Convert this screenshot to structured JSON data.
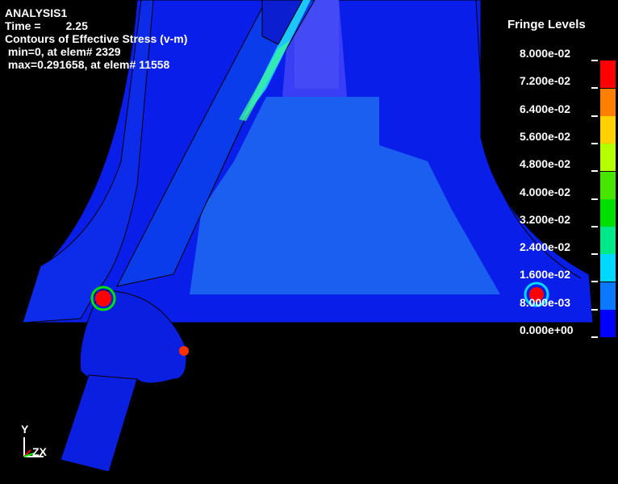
{
  "header": {
    "analysis": "ANALYSIS1",
    "time_line": "Time =        2.25",
    "contour_line": "Contours of Effective Stress (v-m)",
    "min_line": " min=0, at elem# 2329",
    "max_line": " max=0.291658, at elem# 11558"
  },
  "legend": {
    "title": "Fringe Levels",
    "levels": [
      {
        "label": "8.000e-02",
        "color": null
      },
      {
        "label": "7.200e-02",
        "color": "#ff0000"
      },
      {
        "label": "6.400e-02",
        "color": "#ff7f00"
      },
      {
        "label": "5.600e-02",
        "color": "#ffd200"
      },
      {
        "label": "4.800e-02",
        "color": "#b5ff00"
      },
      {
        "label": "4.000e-02",
        "color": "#46e600"
      },
      {
        "label": "3.200e-02",
        "color": "#00e000"
      },
      {
        "label": "2.400e-02",
        "color": "#00e887"
      },
      {
        "label": "1.600e-02",
        "color": "#00d8ff"
      },
      {
        "label": "8.000e-03",
        "color": "#0a78ff"
      },
      {
        "label": "0.000e+00",
        "color": "#0000ff"
      }
    ]
  },
  "triad": {
    "y": "Y",
    "zx": "ZX"
  },
  "colors": {
    "background": "#000000",
    "base_blue": "#0a1eea",
    "mid_blue": "#1b63ea",
    "light_blue": "#1a88f0"
  }
}
